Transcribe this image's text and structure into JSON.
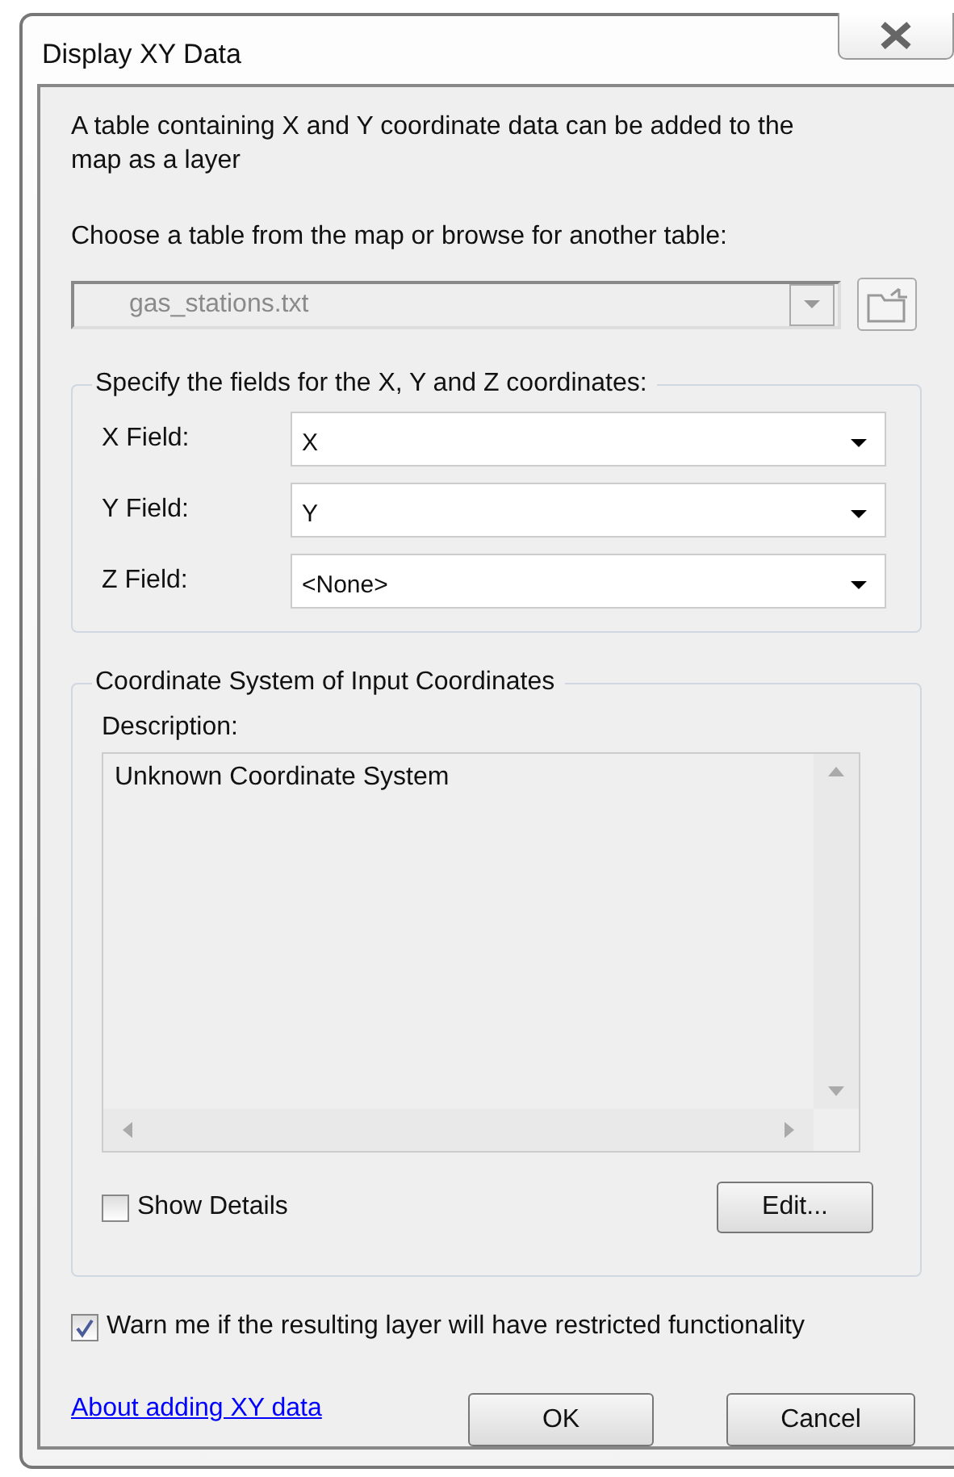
{
  "window": {
    "title": "Display XY Data"
  },
  "intro": "A table containing X and Y coordinate data can be added to the map as a layer",
  "table_prompt": "Choose a table from the map or browse for another table:",
  "table_combo": {
    "value": "gas_stations.txt",
    "disabled": true
  },
  "fields_group": {
    "legend": "Specify the fields for the X, Y and Z coordinates:",
    "fields": [
      {
        "label": "X Field:",
        "value": "X"
      },
      {
        "label": "Y Field:",
        "value": "Y"
      },
      {
        "label": "Z Field:",
        "value": "<None>"
      }
    ]
  },
  "coordinate_group": {
    "legend": "Coordinate System of Input Coordinates",
    "description_label": "Description:",
    "description": "Unknown Coordinate System",
    "show_details": {
      "label": "Show Details",
      "checked": false
    },
    "edit_button": "Edit..."
  },
  "warn": {
    "label": "Warn me if the resulting layer will have restricted functionality",
    "checked": true
  },
  "help_link": "About adding XY data",
  "buttons": [
    "OK",
    "Cancel"
  ]
}
